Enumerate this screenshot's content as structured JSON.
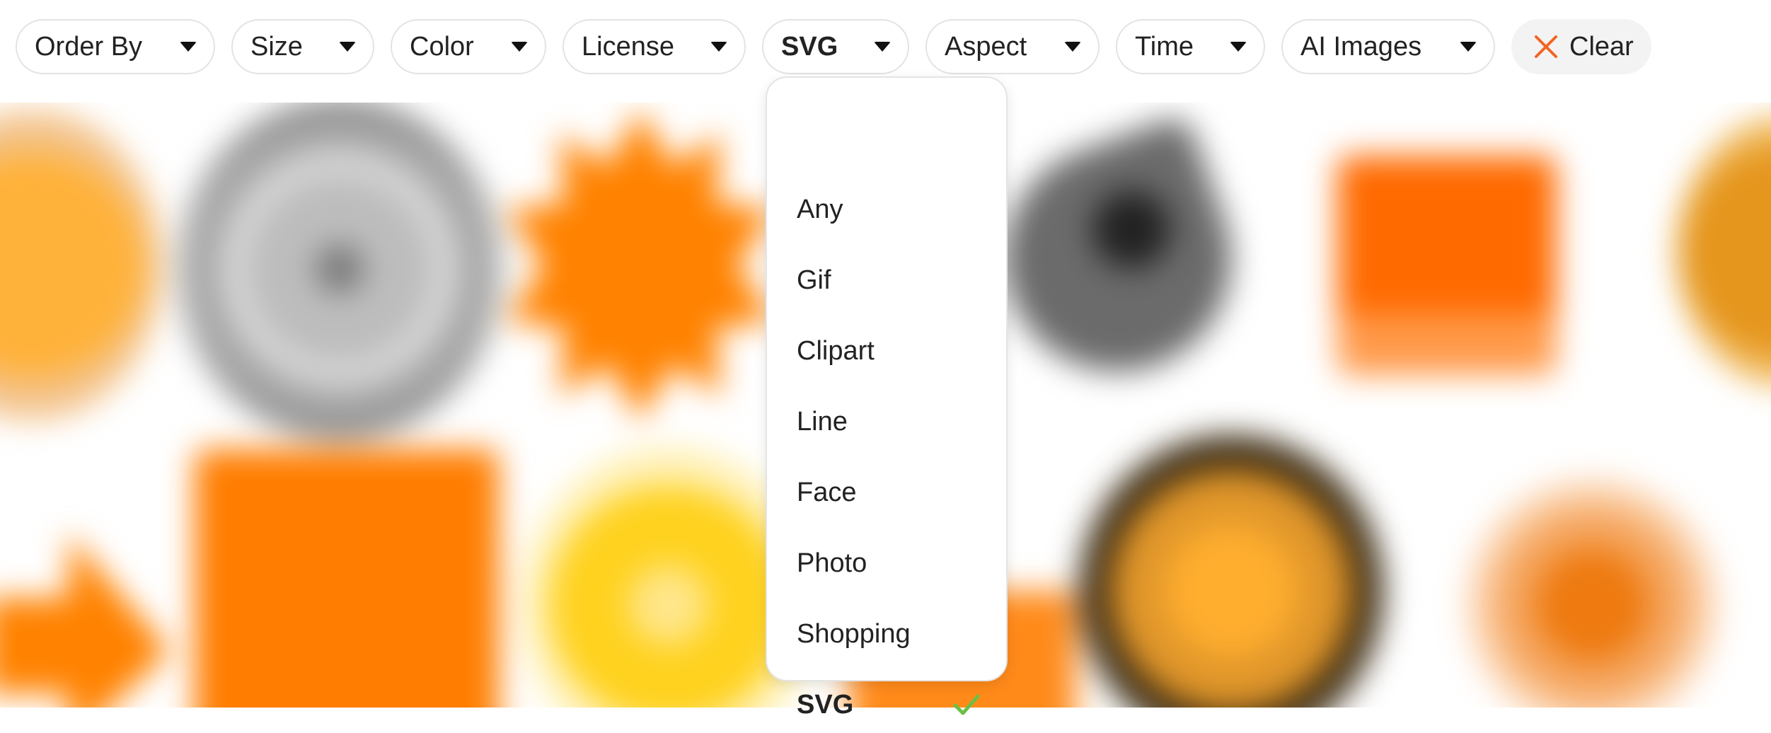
{
  "filters": [
    {
      "label": "Order By"
    },
    {
      "label": "Size"
    },
    {
      "label": "Color"
    },
    {
      "label": "License"
    },
    {
      "label": "SVG",
      "active": true
    },
    {
      "label": "Aspect"
    },
    {
      "label": "Time"
    },
    {
      "label": "AI Images"
    }
  ],
  "clear": {
    "label": "Clear",
    "icon": "close-icon",
    "icon_color": "#f26522"
  },
  "caret_icon": "caret-down-icon",
  "dropdown": {
    "options": [
      "Any",
      "Gif",
      "Clipart",
      "Line",
      "Face",
      "Photo",
      "Shopping",
      "SVG"
    ],
    "selected": "SVG",
    "selected_icon": "check-icon",
    "check_color": "#6cbf45"
  },
  "colors": {
    "accent_orange": "#ff7a00",
    "chip_border": "#e3e3e3",
    "clear_bg": "#f3f3f3"
  }
}
